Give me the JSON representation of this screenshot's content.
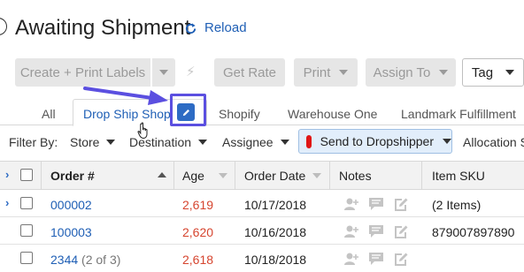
{
  "header": {
    "title": "Awaiting Shipment",
    "reload_label": "Reload"
  },
  "toolbar": {
    "create_label": "Create + Print Labels",
    "get_rate_label": "Get Rate",
    "print_label": "Print",
    "assign_label": "Assign To",
    "tag_label": "Tag"
  },
  "tabs": [
    {
      "label": "All"
    },
    {
      "label": "Drop Ship Shop"
    },
    {
      "label": "Shopify"
    },
    {
      "label": "Warehouse One"
    },
    {
      "label": "Landmark Fulfillment"
    }
  ],
  "filters": {
    "label": "Filter By:",
    "store": "Store",
    "destination": "Destination",
    "assignee": "Assignee",
    "send_to_dropshipper": "Send to Dropshipper",
    "allocation": "Allocation S"
  },
  "table": {
    "columns": [
      "Order #",
      "Age",
      "Order Date",
      "Notes",
      "Item SKU"
    ],
    "rows": [
      {
        "order": "000002",
        "order_sub": "",
        "age": "2,619",
        "date": "10/17/2018",
        "sku": "(2 Items)",
        "expandable": true
      },
      {
        "order": "100003",
        "order_sub": "",
        "age": "2,620",
        "date": "10/16/2018",
        "sku": "879007897890",
        "expandable": false
      },
      {
        "order": "2344",
        "order_sub": " (2 of 3)",
        "age": "2,618",
        "date": "10/18/2018",
        "sku": "",
        "expandable": false
      }
    ]
  },
  "colors": {
    "accent": "#1f5fb5",
    "annotation": "#5b4fe0",
    "age_warning": "#d6452f",
    "dropship_tag": "#e01616"
  }
}
